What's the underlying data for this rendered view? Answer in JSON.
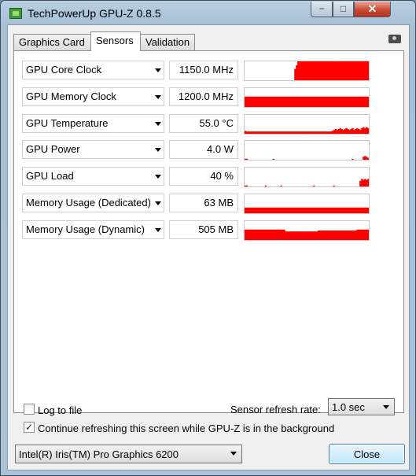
{
  "window": {
    "title": "TechPowerUp GPU-Z 0.8.5",
    "minimize_glyph": "−",
    "maximize_glyph": "□",
    "close_glyph": "✕"
  },
  "tabs": [
    {
      "label": "Graphics Card",
      "active": false
    },
    {
      "label": "Sensors",
      "active": true
    },
    {
      "label": "Validation",
      "active": false
    }
  ],
  "sensors": [
    {
      "name": "GPU Core Clock",
      "value": "1150.0 MHz",
      "history": [
        0,
        0,
        0,
        0,
        0,
        0,
        0,
        0,
        0,
        0,
        0,
        0,
        0,
        0,
        0,
        0,
        0,
        0,
        0,
        0,
        0,
        0,
        0,
        0,
        0,
        0,
        0,
        0,
        0,
        0,
        0,
        0,
        0.6,
        0.8,
        1,
        1,
        1,
        1,
        1,
        1,
        1,
        1,
        1,
        1,
        1,
        1,
        1,
        1,
        1,
        1,
        1,
        1,
        1,
        1,
        1,
        1,
        1,
        1,
        1,
        1,
        1,
        1,
        1,
        1,
        1,
        1,
        1,
        1,
        1,
        1,
        1,
        1,
        1,
        1,
        1,
        1,
        1,
        1,
        1,
        1
      ]
    },
    {
      "name": "GPU Memory Clock",
      "value": "1200.0 MHz",
      "history": [
        0.55,
        0.55,
        0.55,
        0.55,
        0.55,
        0.55,
        0.55,
        0.55,
        0.55,
        0.55,
        0.55,
        0.55,
        0.55,
        0.55,
        0.55,
        0.55,
        0.55,
        0.55,
        0.55,
        0.55,
        0.55,
        0.55,
        0.55,
        0.55,
        0.55,
        0.55,
        0.55,
        0.55,
        0.55,
        0.55,
        0.55,
        0.55,
        0.55,
        0.55,
        0.55,
        0.55,
        0.55,
        0.55,
        0.55,
        0.55,
        0.55,
        0.55,
        0.55,
        0.55,
        0.55,
        0.55,
        0.55,
        0.55,
        0.55,
        0.55,
        0.55,
        0.55,
        0.55,
        0.55,
        0.55,
        0.55,
        0.55,
        0.55,
        0.55,
        0.55,
        0.55,
        0.55,
        0.55,
        0.55,
        0.55,
        0.55,
        0.55,
        0.55,
        0.55,
        0.55,
        0.55,
        0.55,
        0.55,
        0.55,
        0.55,
        0.55,
        0.55,
        0.55,
        0.55,
        0.55
      ]
    },
    {
      "name": "GPU Temperature",
      "value": "55.0 °C",
      "history": [
        0.15,
        0.12,
        0.12,
        0.12,
        0.12,
        0.12,
        0.12,
        0.12,
        0.12,
        0.12,
        0.12,
        0.12,
        0.12,
        0.12,
        0.12,
        0.12,
        0.12,
        0.12,
        0.12,
        0.12,
        0.12,
        0.12,
        0.12,
        0.12,
        0.12,
        0.12,
        0.12,
        0.12,
        0.12,
        0.12,
        0.12,
        0.12,
        0.12,
        0.12,
        0.12,
        0.12,
        0.12,
        0.12,
        0.12,
        0.12,
        0.12,
        0.12,
        0.12,
        0.12,
        0.12,
        0.12,
        0.12,
        0.12,
        0.12,
        0.12,
        0.12,
        0.12,
        0.12,
        0.12,
        0.12,
        0.12,
        0.15,
        0.2,
        0.25,
        0.2,
        0.25,
        0.3,
        0.25,
        0.2,
        0.25,
        0.3,
        0.25,
        0.2,
        0.25,
        0.3,
        0.2,
        0.25,
        0.3,
        0.25,
        0.2,
        0.3,
        0.35,
        0.3,
        0.35,
        0.3
      ]
    },
    {
      "name": "GPU Power",
      "value": "4.0 W",
      "history": [
        0.05,
        0.05,
        0,
        0,
        0,
        0,
        0,
        0,
        0,
        0,
        0,
        0,
        0,
        0,
        0,
        0,
        0,
        0,
        0.05,
        0,
        0,
        0,
        0,
        0,
        0,
        0,
        0,
        0,
        0,
        0,
        0,
        0,
        0,
        0,
        0,
        0,
        0,
        0,
        0,
        0,
        0,
        0,
        0,
        0,
        0,
        0,
        0,
        0,
        0,
        0,
        0,
        0,
        0,
        0,
        0,
        0,
        0,
        0,
        0,
        0,
        0,
        0,
        0,
        0,
        0,
        0,
        0,
        0,
        0,
        0.05,
        0,
        0,
        0,
        0,
        0,
        0,
        0.15,
        0.2,
        0.15,
        0.1
      ]
    },
    {
      "name": "GPU Load",
      "value": "40 %",
      "history": [
        0.05,
        0.05,
        0,
        0,
        0,
        0,
        0,
        0,
        0,
        0,
        0,
        0,
        0,
        0.05,
        0,
        0,
        0,
        0,
        0,
        0,
        0,
        0,
        0,
        0.05,
        0,
        0,
        0,
        0,
        0,
        0,
        0,
        0,
        0,
        0,
        0,
        0,
        0,
        0,
        0,
        0,
        0,
        0,
        0,
        0,
        0.05,
        0,
        0,
        0,
        0,
        0,
        0,
        0,
        0,
        0,
        0,
        0,
        0,
        0.05,
        0,
        0,
        0,
        0,
        0,
        0,
        0,
        0,
        0,
        0,
        0,
        0,
        0,
        0,
        0,
        0,
        0.3,
        0.4,
        0.35,
        0.4,
        0.35,
        0.4
      ]
    },
    {
      "name": "Memory Usage (Dedicated)",
      "value": "63 MB",
      "history": [
        0.3,
        0.3,
        0.3,
        0.3,
        0.3,
        0.3,
        0.3,
        0.3,
        0.3,
        0.3,
        0.3,
        0.3,
        0.3,
        0.3,
        0.3,
        0.3,
        0.3,
        0.3,
        0.3,
        0.3,
        0.3,
        0.3,
        0.3,
        0.3,
        0.3,
        0.3,
        0.3,
        0.3,
        0.3,
        0.3,
        0.3,
        0.3,
        0.3,
        0.3,
        0.3,
        0.3,
        0.3,
        0.3,
        0.3,
        0.3,
        0.3,
        0.3,
        0.3,
        0.3,
        0.3,
        0.3,
        0.3,
        0.3,
        0.3,
        0.3,
        0.3,
        0.3,
        0.3,
        0.3,
        0.3,
        0.3,
        0.3,
        0.3,
        0.3,
        0.3,
        0.3,
        0.3,
        0.3,
        0.3,
        0.3,
        0.3,
        0.3,
        0.3,
        0.3,
        0.3,
        0.3,
        0.3,
        0.3,
        0.3,
        0.3,
        0.3,
        0.3,
        0.3,
        0.3,
        0.3
      ]
    },
    {
      "name": "Memory Usage (Dynamic)",
      "value": "505 MB",
      "history": [
        0.55,
        0.55,
        0.55,
        0.55,
        0.55,
        0.55,
        0.55,
        0.55,
        0.55,
        0.55,
        0.55,
        0.55,
        0.55,
        0.55,
        0.55,
        0.55,
        0.55,
        0.55,
        0.55,
        0.55,
        0.55,
        0.55,
        0.55,
        0.55,
        0.55,
        0.55,
        0.45,
        0.45,
        0.45,
        0.45,
        0.45,
        0.45,
        0.45,
        0.45,
        0.45,
        0.45,
        0.45,
        0.45,
        0.45,
        0.45,
        0.45,
        0.45,
        0.45,
        0.45,
        0.45,
        0.45,
        0.45,
        0.5,
        0.5,
        0.5,
        0.5,
        0.5,
        0.5,
        0.5,
        0.5,
        0.5,
        0.5,
        0.5,
        0.5,
        0.5,
        0.5,
        0.5,
        0.5,
        0.5,
        0.5,
        0.5,
        0.5,
        0.5,
        0.5,
        0.5,
        0.5,
        0.5,
        0.55,
        0.55,
        0.55,
        0.55,
        0.55,
        0.55,
        0.55,
        0.55
      ]
    }
  ],
  "graph_color": "#ff0000",
  "options": {
    "log_to_file": {
      "label": "Log to file",
      "checked": false
    },
    "continue_refreshing": {
      "label": "Continue refreshing this screen while GPU-Z is in the background",
      "checked": true,
      "check_glyph": "✓"
    }
  },
  "refresh": {
    "label": "Sensor refresh rate:",
    "value": "1.0 sec"
  },
  "gpu_select": {
    "value": "Intel(R) Iris(TM) Pro Graphics 6200"
  },
  "close_button": {
    "label": "Close"
  }
}
